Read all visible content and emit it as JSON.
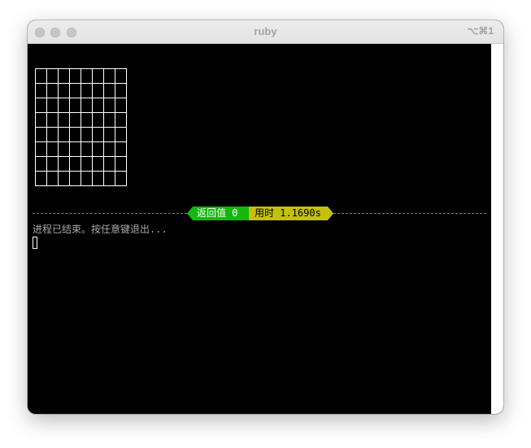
{
  "window": {
    "title": "ruby",
    "shortcut": "⌥⌘1"
  },
  "terminal": {
    "status": {
      "return_label": "返回值 0",
      "time_label": "用时 1.169​0s"
    },
    "message": "进程已结束。按任意键退出...",
    "grid": {
      "columns": 8,
      "rows": 8,
      "line_color": "#ffffff"
    }
  },
  "colors": {
    "terminal_bg": "#000000",
    "return_badge": "#13b80c",
    "time_badge": "#c3c10c",
    "message_text": "#a8a8a8",
    "titlebar_text": "#a3a3a3"
  }
}
